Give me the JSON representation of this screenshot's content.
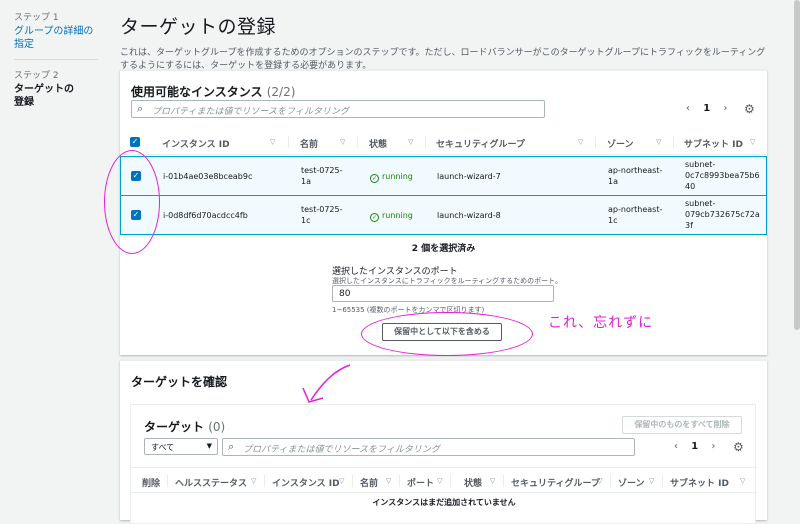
{
  "sidebar": {
    "step1_num": "ステップ 1",
    "step1_label": "グループの詳細の指定",
    "step2_num": "ステップ 2",
    "step2_label": "ターゲットの登録"
  },
  "page": {
    "title": "ターゲットの登録",
    "description": "これは、ターゲットグループを作成するためのオプションのステップです。ただし、ロードバランサーがこのターゲットグループにトラフィックをルーティングするようにするには、ターゲットを登録する必要があります。"
  },
  "available": {
    "title": "使用可能なインスタンス",
    "count": "(2/2)",
    "search_placeholder": "プロパティまたは値でリソースをフィルタリング",
    "page": "1",
    "columns": [
      "インスタンス ID",
      "名前",
      "状態",
      "セキュリティグループ",
      "ゾーン",
      "サブネット ID"
    ],
    "rows": [
      {
        "id": "i-01b4ae03e8bceab9c",
        "name": "test-0725-\n1a",
        "state": "running",
        "sg": "launch-wizard-7",
        "zone": "ap-northeast-\n1a",
        "subnet": "subnet-\n0c7c8993bea75b6\n40"
      },
      {
        "id": "i-0d8df6d70acdcc4fb",
        "name": "test-0725-\n1c",
        "state": "running",
        "sg": "launch-wizard-8",
        "zone": "ap-northeast-\n1c",
        "subnet": "subnet-\n079cb732675c72a\n3f"
      }
    ],
    "selected_text": "2 個を選択済み",
    "port_label": "選択したインスタンスのポート",
    "port_hint": "選択したインスタンスにトラフィックをルーティングするためのポート。",
    "port_value": "80",
    "port_range": "1~65535 (複数のポートをカンマで区切ります)",
    "include_button": "保留中として以下を含める"
  },
  "annotation": {
    "note": "これ、忘れずに"
  },
  "review": {
    "title": "ターゲットを確認",
    "targets_title": "ターゲット",
    "targets_count": "(0)",
    "remove_all_button": "保留中のものをすべて削除",
    "filter_select": "すべて",
    "search_placeholder": "プロパティまたは値でリソースをフィルタリング",
    "page": "1",
    "columns": [
      "削除",
      "ヘルスステータス",
      "インスタンス ID",
      "名前",
      "ポート",
      "状態",
      "セキュリティグループ",
      "ゾーン",
      "サブネット ID"
    ],
    "empty_text": "インスタンスはまだ追加されていません"
  },
  "colors": {
    "accent": "#0073bb",
    "annotation": "#e51ed8",
    "running": "#1d8102"
  }
}
